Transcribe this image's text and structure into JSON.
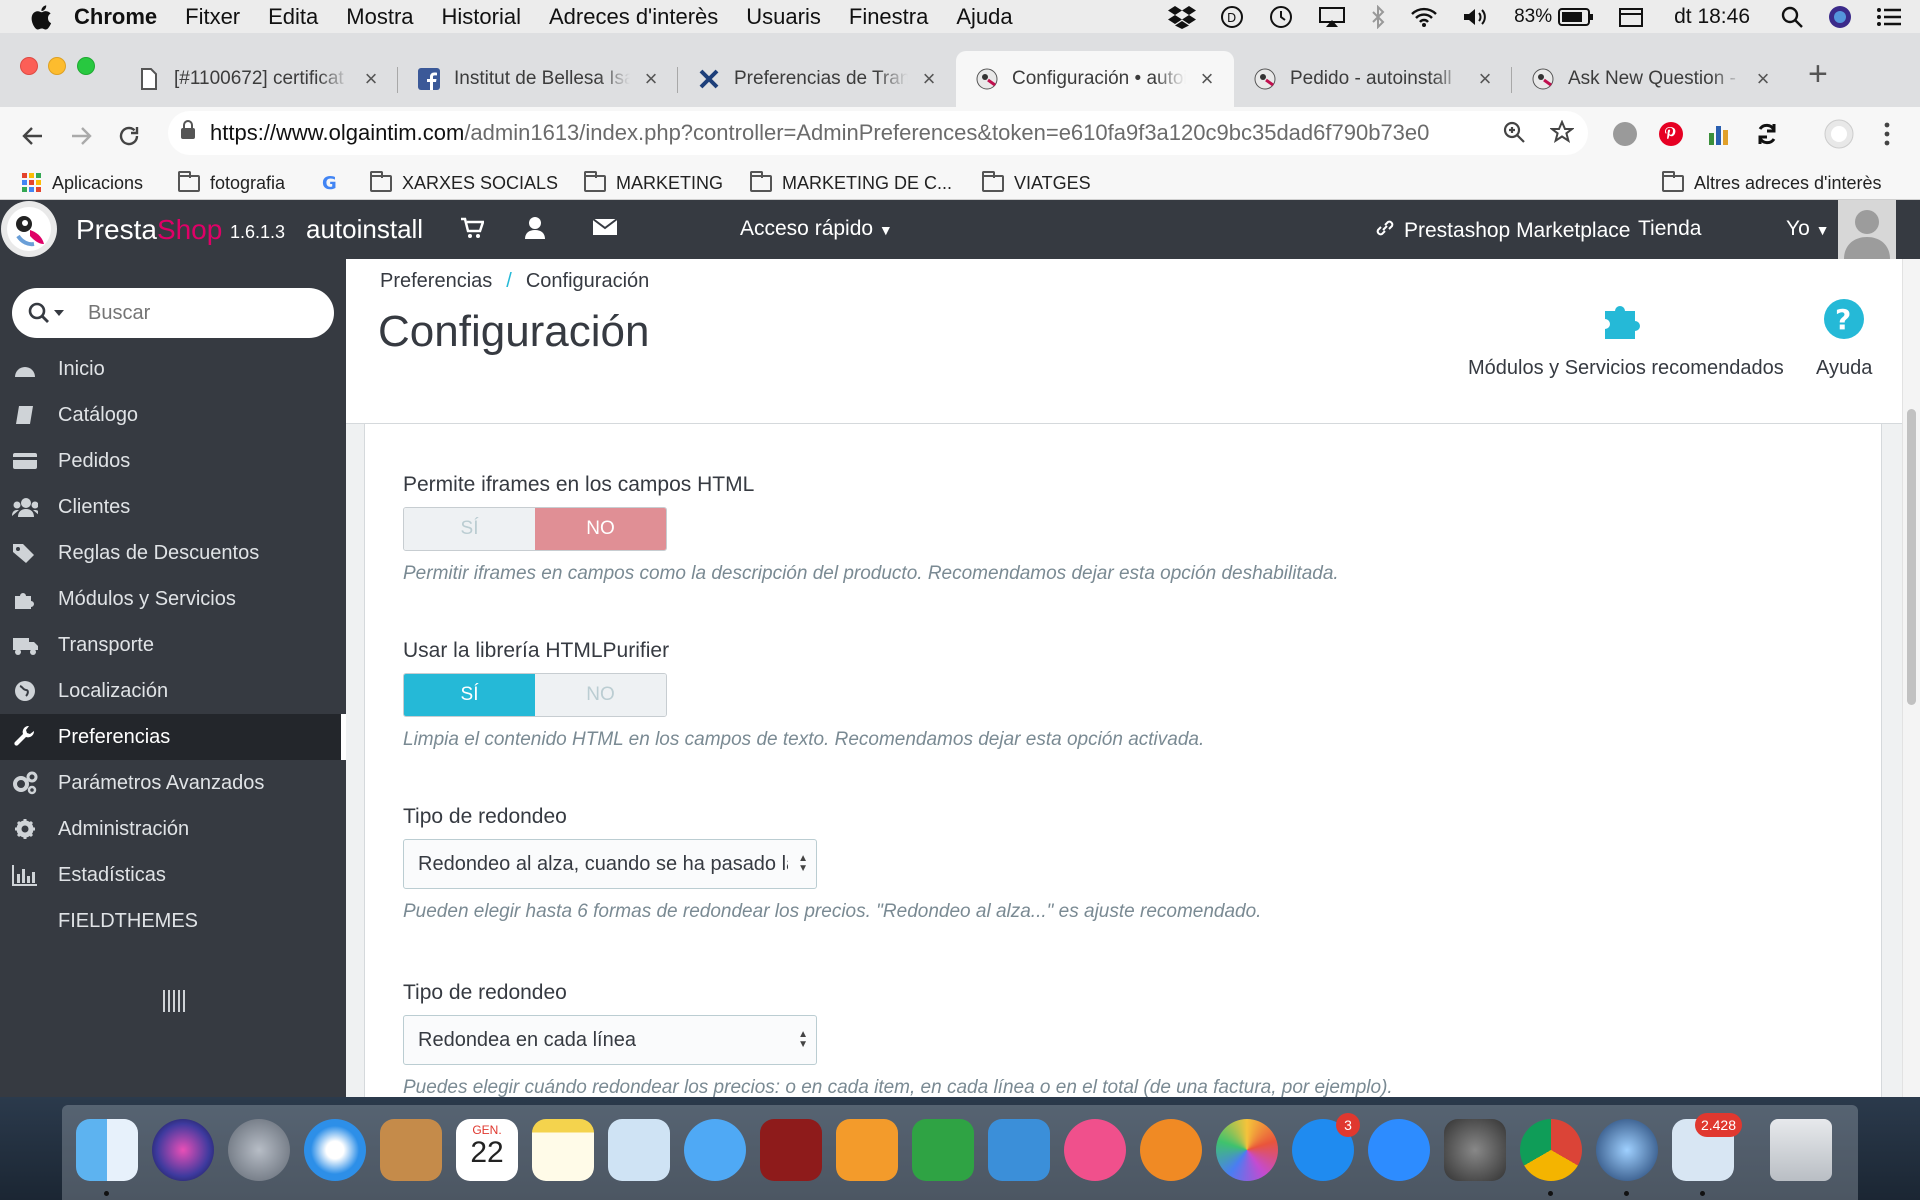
{
  "menubar": {
    "app": "Chrome",
    "items": [
      "Fitxer",
      "Edita",
      "Mostra",
      "Historial",
      "Adreces d'interès",
      "Usuaris",
      "Finestra",
      "Ajuda"
    ],
    "battery": "83%",
    "clock": "dt 18:46"
  },
  "tabs": [
    {
      "title": "[#1100672] certificat",
      "icon": "document-icon"
    },
    {
      "title": "Institut de Bellesa Isa",
      "icon": "facebook-icon"
    },
    {
      "title": "Preferencias de Trans",
      "icon": "tools-icon"
    },
    {
      "title": "Configuración • autoi",
      "icon": "prestashop-icon"
    },
    {
      "title": "Pedido - autoinstall",
      "icon": "prestashop-icon"
    },
    {
      "title": "Ask New Question - F",
      "icon": "prestashop-icon"
    }
  ],
  "omnibox": {
    "host": "https://www.olgaintim.com",
    "path": "/admin1613/index.php?controller=AdminPreferences&token=e610fa9f3a120c9bc35dad6f790b73e0"
  },
  "bookmarks": {
    "apps": "Aplicacions",
    "items": [
      "fotografia",
      "XARXES SOCIALS",
      "MARKETING",
      "MARKETING DE C...",
      "VIATGES"
    ],
    "other": "Altres adreces d'interès"
  },
  "header": {
    "brand_a": "Presta",
    "brand_b": "Shop",
    "version": "1.6.1.3",
    "store": "autoinstall",
    "quick_access": "Acceso rápido",
    "marketplace": "Prestashop Marketplace",
    "shop": "Tienda",
    "me": "Yo"
  },
  "sidebar": {
    "search_placeholder": "Buscar",
    "items": [
      {
        "label": "Inicio"
      },
      {
        "label": "Catálogo"
      },
      {
        "label": "Pedidos"
      },
      {
        "label": "Clientes"
      },
      {
        "label": "Reglas de Descuentos"
      },
      {
        "label": "Módulos y Servicios"
      },
      {
        "label": "Transporte"
      },
      {
        "label": "Localización"
      },
      {
        "label": "Preferencias"
      },
      {
        "label": "Parámetros Avanzados"
      },
      {
        "label": "Administración"
      },
      {
        "label": "Estadísticas"
      },
      {
        "label": "FIELDTHEMES"
      }
    ]
  },
  "page": {
    "breadcrumb_parent": "Preferencias",
    "breadcrumb_current": "Configuración",
    "title": "Configuración",
    "btn_modules": "Módulos y Servicios recomendados",
    "btn_help": "Ayuda"
  },
  "form": {
    "iframes": {
      "label": "Permite iframes en los campos HTML",
      "yes": "SÍ",
      "no": "NO",
      "value": "NO",
      "help": "Permitir iframes en campos como la descripción del producto. Recomendamos dejar esta opción deshabilitada."
    },
    "purifier": {
      "label": "Usar la librería HTMLPurifier",
      "yes": "SÍ",
      "no": "NO",
      "value": "SÍ",
      "help": "Limpia el contenido HTML en los campos de texto. Recomendamos dejar esta opción activada."
    },
    "round_mode": {
      "label": "Tipo de redondeo",
      "value": "Redondeo al alza, cuando se ha pasado la mitad",
      "help": "Pueden elegir hasta 6 formas de redondear los precios. \"Redondeo al alza...\" es ajuste recomendado."
    },
    "round_type": {
      "label": "Tipo de redondeo",
      "value": "Redondea en cada línea",
      "help": "Puedes elegir cuándo redondear los precios: o en cada item, en cada línea o en el total (de una factura, por ejemplo)."
    }
  },
  "dock": {
    "calendar_month": "GEN.",
    "calendar_day": "22",
    "appstore_badge": "3",
    "mail_badge": "2.428"
  },
  "colors": {
    "accent": "#25b9d7",
    "toggle_no": "#e08f95",
    "sidebar": "#363a41",
    "brand_pink": "#df0067"
  }
}
